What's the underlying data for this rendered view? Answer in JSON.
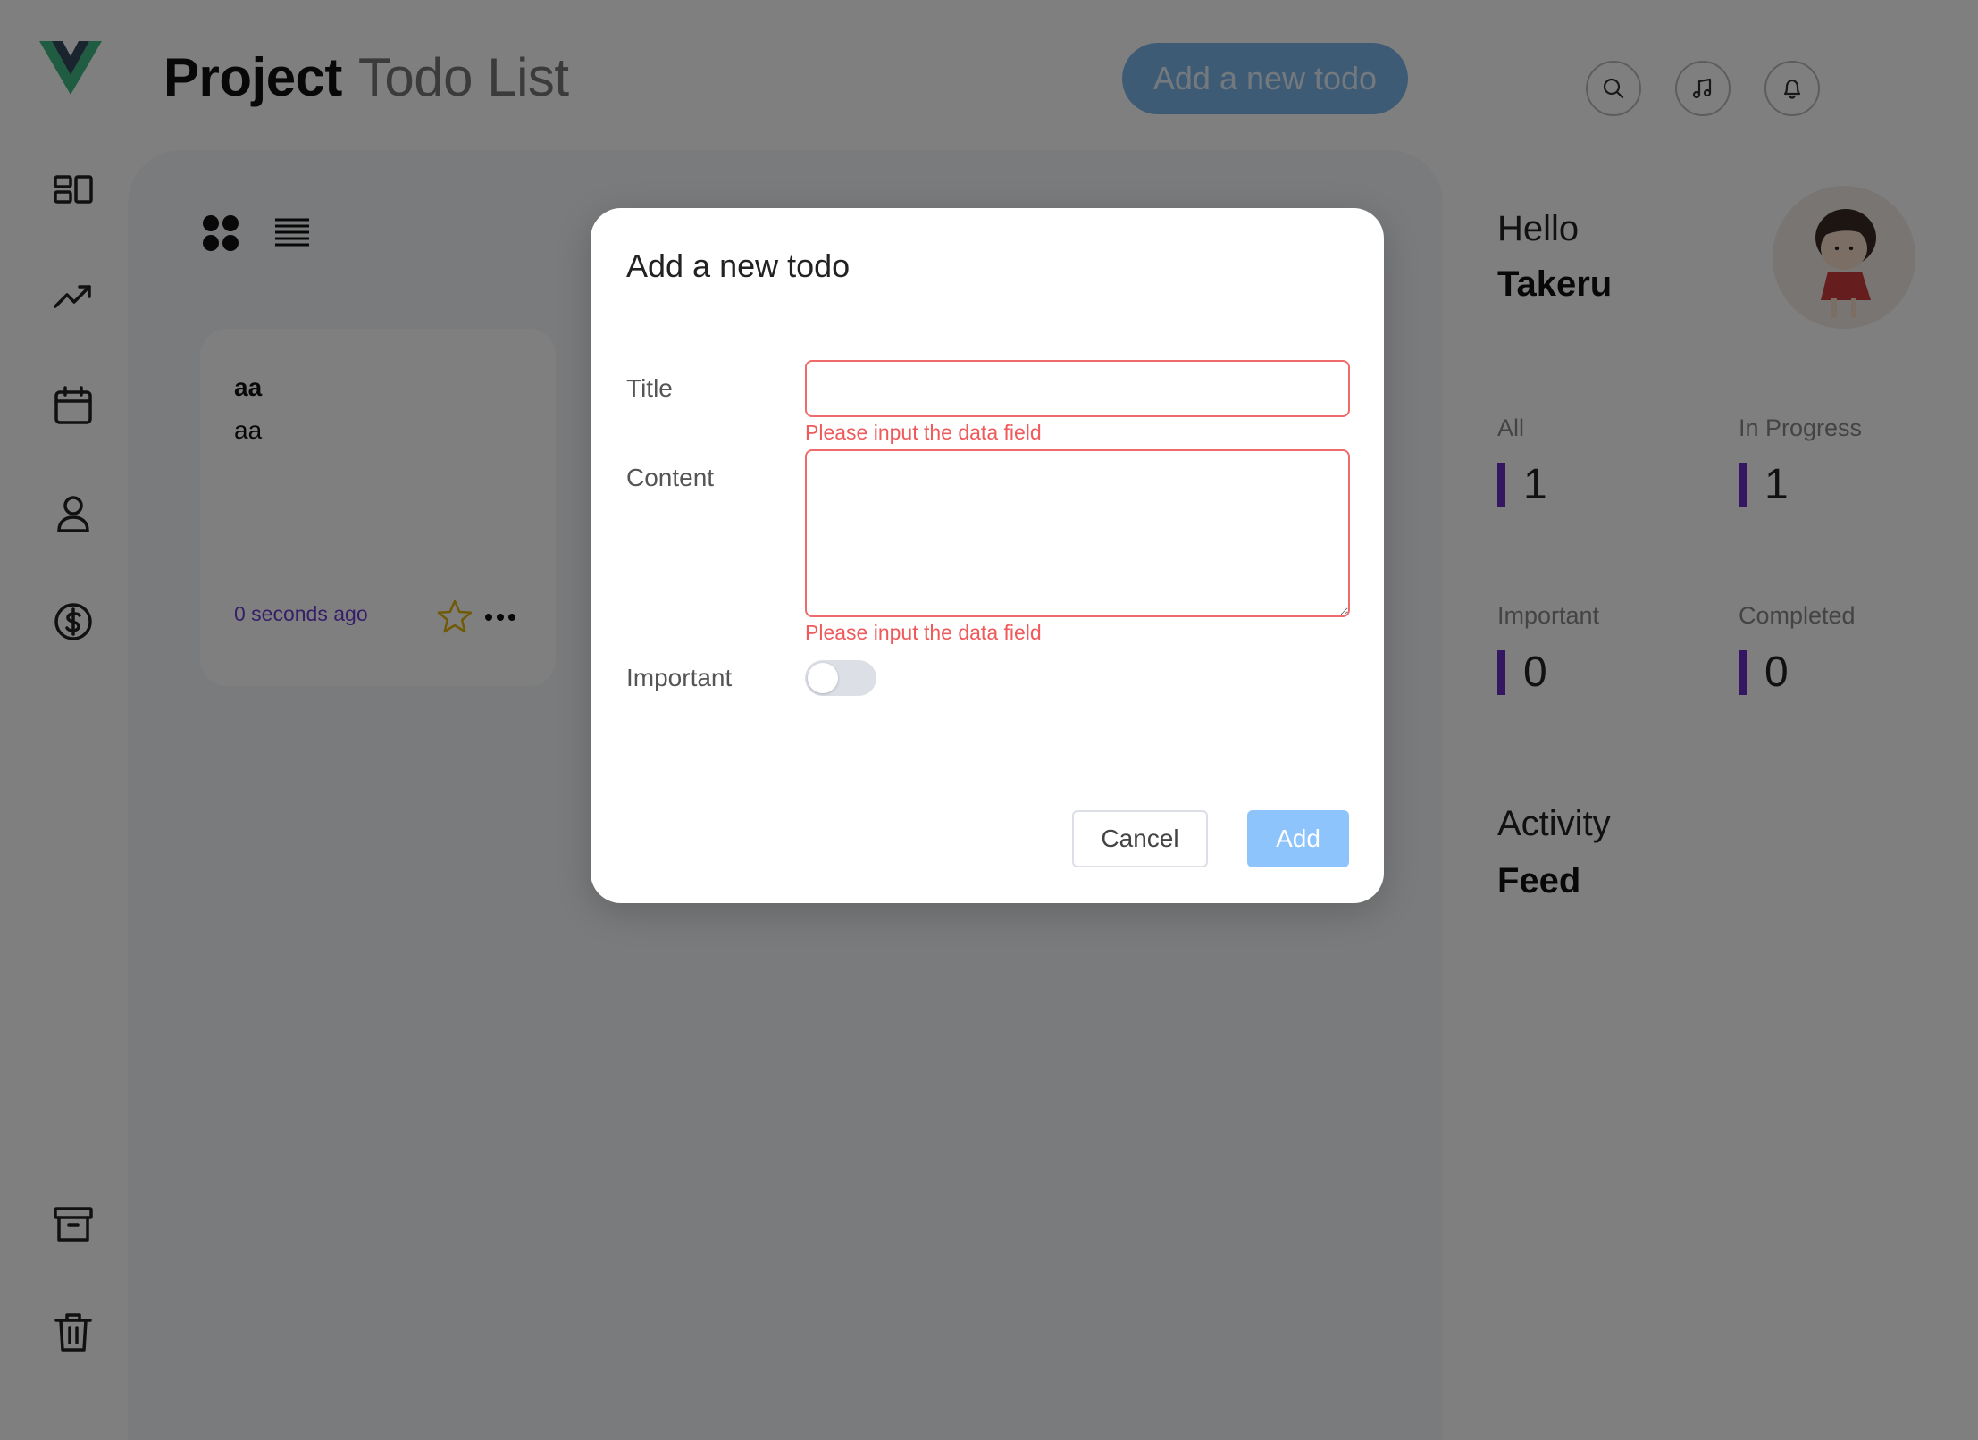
{
  "header": {
    "title_strong": "Project",
    "title_light": "Todo List",
    "add_button_label": "Add a new todo",
    "icons": [
      "search-icon",
      "music-icon",
      "bell-icon"
    ]
  },
  "sidebar": {
    "items": [
      {
        "icon": "dashboard-icon"
      },
      {
        "icon": "trending-icon"
      },
      {
        "icon": "calendar-icon"
      },
      {
        "icon": "user-icon"
      },
      {
        "icon": "dollar-icon"
      }
    ],
    "bottom_items": [
      {
        "icon": "archive-icon"
      },
      {
        "icon": "trash-icon"
      }
    ]
  },
  "main": {
    "view_toggles": [
      "grid-view-icon",
      "list-view-icon"
    ],
    "todos": [
      {
        "title": "aa",
        "content": "aa",
        "time": "0 seconds ago"
      }
    ]
  },
  "right_panel": {
    "greeting": "Hello",
    "username": "Takeru",
    "stats": [
      {
        "label": "All",
        "value": "1"
      },
      {
        "label": "In Progress",
        "value": "1"
      },
      {
        "label": "Important",
        "value": "0"
      },
      {
        "label": "Completed",
        "value": "0"
      }
    ],
    "activity_label": "Activity",
    "feed_label": "Feed"
  },
  "modal": {
    "title": "Add a new todo",
    "title_label": "Title",
    "content_label": "Content",
    "important_label": "Important",
    "title_value": "",
    "content_value": "",
    "title_error": "Please input the data field",
    "content_error": "Please input the data field",
    "important_on": false,
    "cancel_label": "Cancel",
    "add_label": "Add"
  },
  "colors": {
    "accent": "#7db6ec",
    "error": "#ef5a5a",
    "stat_bar": "#6a2cc4",
    "time_text": "#6b3fd0",
    "logo_green": "#41b883",
    "logo_dark": "#35495e"
  }
}
